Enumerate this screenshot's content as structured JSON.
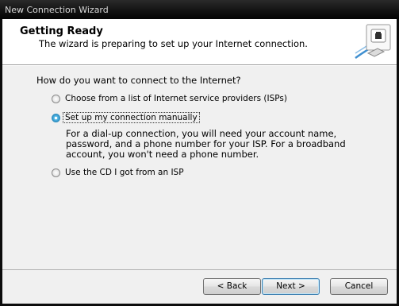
{
  "window": {
    "title": "New Connection Wizard"
  },
  "header": {
    "title": "Getting Ready",
    "subtitle": "The wizard is preparing to set up your Internet connection."
  },
  "main": {
    "question": "How do you want to connect to the Internet?",
    "options": [
      {
        "label": "Choose from a list of Internet service providers (ISPs)",
        "selected": false
      },
      {
        "label": "Set up my connection manually",
        "selected": true
      },
      {
        "label": "Use the CD I got from an ISP",
        "selected": false
      }
    ],
    "description": "For a dial-up connection, you will need your account name, password, and a phone number for your ISP. For a broadband account, you won't need a phone number."
  },
  "buttons": {
    "back": "< Back",
    "next": "Next >",
    "cancel": "Cancel"
  },
  "icons": {
    "header_icon": "network-connection-icon"
  },
  "colors": {
    "titlebar": "#111111",
    "radio_selected": "#2f8ec5",
    "default_button_border": "#3c7fb1"
  }
}
